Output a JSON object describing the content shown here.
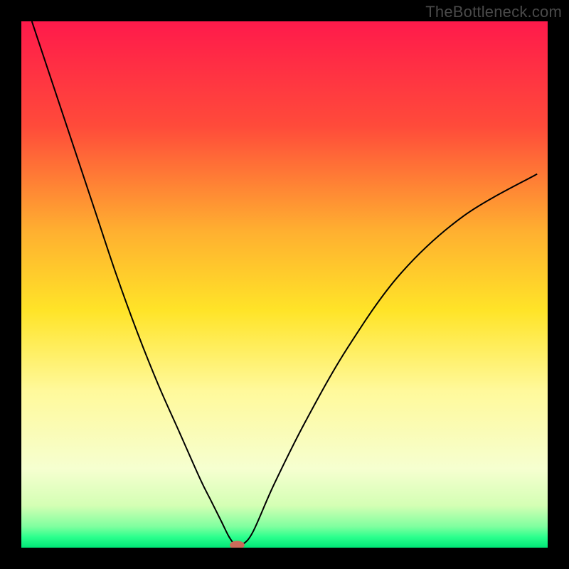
{
  "watermark": "TheBottleneck.com",
  "chart_data": {
    "type": "line",
    "title": "",
    "xlabel": "",
    "ylabel": "",
    "xlim": [
      0,
      100
    ],
    "ylim": [
      0,
      100
    ],
    "grid": false,
    "legend": false,
    "gradient_stops": [
      {
        "offset": 0,
        "color": "#ff1a4b"
      },
      {
        "offset": 20,
        "color": "#ff4b3a"
      },
      {
        "offset": 40,
        "color": "#ffb030"
      },
      {
        "offset": 55,
        "color": "#ffe428"
      },
      {
        "offset": 70,
        "color": "#fff99a"
      },
      {
        "offset": 85,
        "color": "#f6ffd0"
      },
      {
        "offset": 92,
        "color": "#d4ffb4"
      },
      {
        "offset": 96,
        "color": "#7fff9f"
      },
      {
        "offset": 98,
        "color": "#2bff8d"
      },
      {
        "offset": 100,
        "color": "#00e676"
      }
    ],
    "series": [
      {
        "name": "bottleneck-curve",
        "color": "#000000",
        "x": [
          2,
          6,
          10,
          14,
          18,
          22,
          26,
          30,
          34,
          36,
          38,
          39.5,
          40.8,
          42,
          44,
          48,
          54,
          62,
          72,
          84,
          98
        ],
        "y": [
          100,
          88,
          76,
          64,
          52,
          41,
          31,
          22,
          13,
          9,
          5,
          2,
          0.4,
          0.6,
          3,
          12,
          24,
          38,
          52,
          63,
          71
        ]
      }
    ],
    "marker": {
      "name": "nadir-marker",
      "x": 41,
      "y": 0.5,
      "rx": 1.4,
      "ry": 0.8,
      "fill": "#cc6b5a"
    }
  }
}
